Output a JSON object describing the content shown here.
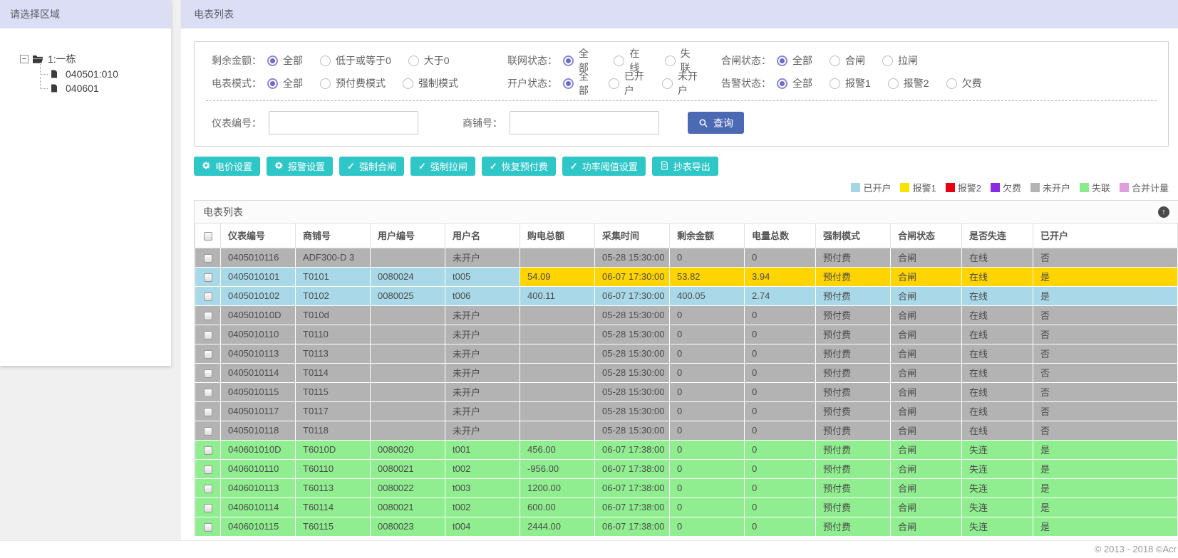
{
  "sidebar": {
    "title": "请选择区域",
    "tree": {
      "root": "1:一栋",
      "children": [
        "040501:010",
        "040601"
      ]
    }
  },
  "header": {
    "title": "电表列表"
  },
  "filters": {
    "rows": [
      [
        {
          "label": "剩余金额：",
          "options": [
            {
              "text": "全部",
              "selected": true
            },
            {
              "text": "低于或等于0",
              "selected": false
            },
            {
              "text": "大于0",
              "selected": false
            }
          ]
        },
        {
          "label": "联网状态：",
          "options": [
            {
              "text": "全部",
              "selected": true
            },
            {
              "text": "在线",
              "selected": false
            },
            {
              "text": "失联",
              "selected": false
            }
          ]
        },
        {
          "label": "合闸状态：",
          "options": [
            {
              "text": "全部",
              "selected": true
            },
            {
              "text": "合闸",
              "selected": false
            },
            {
              "text": "拉闸",
              "selected": false
            }
          ]
        }
      ],
      [
        {
          "label": "电表模式：",
          "options": [
            {
              "text": "全部",
              "selected": true
            },
            {
              "text": "预付费模式",
              "selected": false
            },
            {
              "text": "强制模式",
              "selected": false
            }
          ]
        },
        {
          "label": "开户状态：",
          "options": [
            {
              "text": "全部",
              "selected": true
            },
            {
              "text": "已开户",
              "selected": false
            },
            {
              "text": "未开户",
              "selected": false
            }
          ]
        },
        {
          "label": "告警状态：",
          "options": [
            {
              "text": "全部",
              "selected": true
            },
            {
              "text": "报警1",
              "selected": false
            },
            {
              "text": "报警2",
              "selected": false
            },
            {
              "text": "欠费",
              "selected": false
            }
          ]
        }
      ]
    ],
    "inputs": [
      {
        "label": "仪表编号：",
        "value": "",
        "placeholder": ""
      },
      {
        "label": "商铺号：",
        "value": "",
        "placeholder": ""
      }
    ],
    "search_label": "查询"
  },
  "toolbar": {
    "buttons": [
      {
        "name": "price-setting-button",
        "icon": "gear-icon",
        "label": "电价设置"
      },
      {
        "name": "alarm-setting-button",
        "icon": "gear-icon",
        "label": "报警设置"
      },
      {
        "name": "force-close-button",
        "icon": "check-icon",
        "label": "强制合闸"
      },
      {
        "name": "force-open-button",
        "icon": "check-icon",
        "label": "强制拉闸"
      },
      {
        "name": "restore-prepaid-button",
        "icon": "check-icon",
        "label": "恢复预付费"
      },
      {
        "name": "power-threshold-button",
        "icon": "check-icon",
        "label": "功率阈值设置"
      },
      {
        "name": "export-button",
        "icon": "export-icon",
        "label": "抄表导出"
      }
    ]
  },
  "legend": {
    "items": [
      {
        "label": "已开户",
        "color": "#a5d6e4"
      },
      {
        "label": "报警1",
        "color": "#f7e500"
      },
      {
        "label": "报警2",
        "color": "#e60012"
      },
      {
        "label": "欠费",
        "color": "#8a2be2"
      },
      {
        "label": "未开户",
        "color": "#b3b3b3"
      },
      {
        "label": "失联",
        "color": "#8ce98c"
      },
      {
        "label": "合并计量",
        "color": "#dda0dd"
      }
    ]
  },
  "table": {
    "panel_title": "电表列表",
    "columns": [
      "仪表编号",
      "商铺号",
      "用户编号",
      "用户名",
      "购电总额",
      "采集时间",
      "剩余金额",
      "电量总数",
      "强制模式",
      "合闸状态",
      "是否失连",
      "已开户"
    ],
    "rows": [
      {
        "type": "unopened",
        "cells": [
          "0405010116",
          "ADF300-D 3",
          "",
          "未开户",
          "",
          "05-28 15:30:00",
          "0",
          "0",
          "预付费",
          "合闸",
          "在线",
          "否"
        ]
      },
      {
        "type": "alarm1",
        "cells": [
          "0405010101",
          "T0101",
          "0080024",
          "t005",
          "54.09",
          "06-07 17:30:00",
          "53.82",
          "3.94",
          "预付费",
          "合闸",
          "在线",
          "是"
        ]
      },
      {
        "type": "opened",
        "cells": [
          "0405010102",
          "T0102",
          "0080025",
          "t006",
          "400.11",
          "06-07 17:30:00",
          "400.05",
          "2.74",
          "预付费",
          "合闸",
          "在线",
          "是"
        ]
      },
      {
        "type": "unopened",
        "cells": [
          "040501010D",
          "T010d",
          "",
          "未开户",
          "",
          "05-28 15:30:00",
          "0",
          "0",
          "预付费",
          "合闸",
          "在线",
          "否"
        ]
      },
      {
        "type": "unopened",
        "cells": [
          "0405010110",
          "T0110",
          "",
          "未开户",
          "",
          "05-28 15:30:00",
          "0",
          "0",
          "预付费",
          "合闸",
          "在线",
          "否"
        ]
      },
      {
        "type": "unopened",
        "cells": [
          "0405010113",
          "T0113",
          "",
          "未开户",
          "",
          "05-28 15:30:00",
          "0",
          "0",
          "预付费",
          "合闸",
          "在线",
          "否"
        ]
      },
      {
        "type": "unopened",
        "cells": [
          "0405010114",
          "T0114",
          "",
          "未开户",
          "",
          "05-28 15:30:00",
          "0",
          "0",
          "预付费",
          "合闸",
          "在线",
          "否"
        ]
      },
      {
        "type": "unopened",
        "cells": [
          "0405010115",
          "T0115",
          "",
          "未开户",
          "",
          "05-28 15:30:00",
          "0",
          "0",
          "预付费",
          "合闸",
          "在线",
          "否"
        ]
      },
      {
        "type": "unopened",
        "cells": [
          "0405010117",
          "T0117",
          "",
          "未开户",
          "",
          "05-28 15:30:00",
          "0",
          "0",
          "预付费",
          "合闸",
          "在线",
          "否"
        ]
      },
      {
        "type": "unopened",
        "cells": [
          "0405010118",
          "T0118",
          "",
          "未开户",
          "",
          "05-28 15:30:00",
          "0",
          "0",
          "预付费",
          "合闸",
          "在线",
          "否"
        ]
      },
      {
        "type": "lost",
        "cells": [
          "040601010D",
          "T6010D",
          "0080020",
          "t001",
          "456.00",
          "06-07 17:38:00",
          "0",
          "0",
          "预付费",
          "合闸",
          "失连",
          "是"
        ]
      },
      {
        "type": "lost",
        "cells": [
          "0406010110",
          "T60110",
          "0080021",
          "t002",
          "-956.00",
          "06-07 17:38:00",
          "0",
          "0",
          "预付费",
          "合闸",
          "失连",
          "是"
        ]
      },
      {
        "type": "lost",
        "cells": [
          "0406010113",
          "T60113",
          "0080022",
          "t003",
          "1200.00",
          "06-07 17:38:00",
          "0",
          "0",
          "预付费",
          "合闸",
          "失连",
          "是"
        ]
      },
      {
        "type": "lost",
        "cells": [
          "0406010114",
          "T60114",
          "0080021",
          "t002",
          "600.00",
          "06-07 17:38:00",
          "0",
          "0",
          "预付费",
          "合闸",
          "失连",
          "是"
        ]
      },
      {
        "type": "lost",
        "cells": [
          "0406010115",
          "T60115",
          "0080023",
          "t004",
          "2444.00",
          "06-07 17:38:00",
          "0",
          "0",
          "预付费",
          "合闸",
          "失连",
          "是"
        ]
      }
    ]
  },
  "footer": {
    "copyright": "© 2013 - 2018 ©Acr"
  },
  "colors": {
    "header_lavender": "#dcdef5",
    "accent_teal": "#2fc6c8",
    "query_blue": "#4c6ab3",
    "radio_selected": "#6b68d0",
    "row_unopened": "#b3b3b3",
    "row_opened": "#a9d9e8",
    "row_alarm1": "#ffd400",
    "row_lost": "#90ee90"
  }
}
